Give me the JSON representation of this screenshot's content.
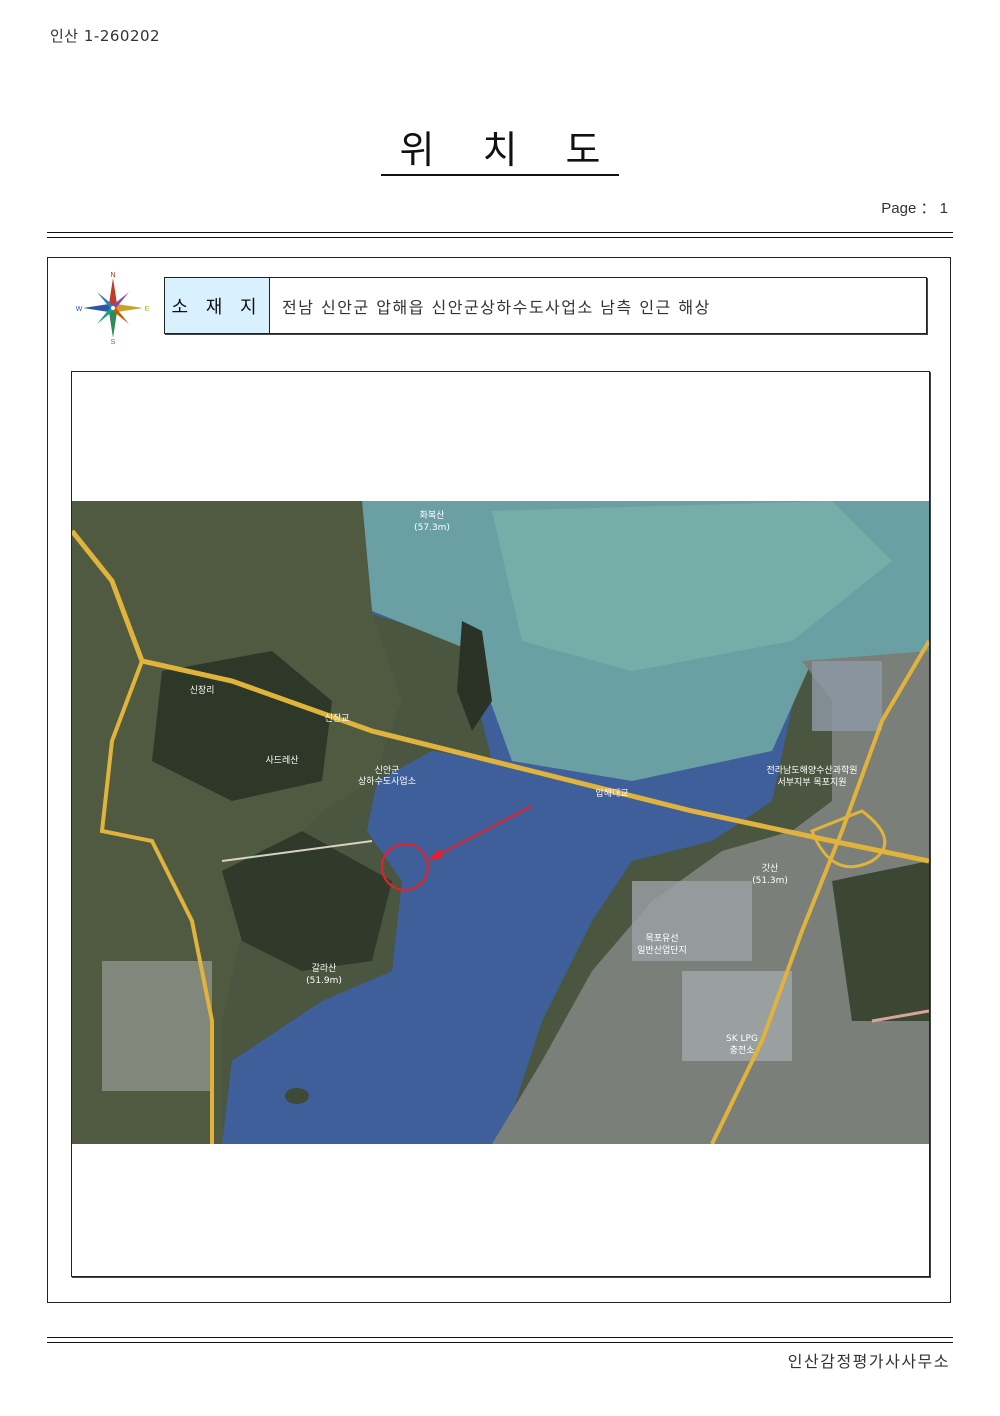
{
  "document": {
    "id": "인산 1-260202",
    "title": "위 치 도",
    "page": "Page ： 1",
    "location_label": "소 재 지",
    "location_value": "전남 신안군 압해읍 신안군상하수도사업소 남측 인근 해상",
    "footer": "인산감정평가사사무소"
  },
  "compass": {
    "north": "N",
    "south": "S",
    "east": "E",
    "west": "W"
  },
  "map": {
    "labels": [
      "화복산",
      "(57.3m)",
      "신장리",
      "사드레산",
      "신안군",
      "상하수도사업소",
      "압해대교",
      "신장교",
      "전라남도해양수산과학원",
      "서부지부 목포지원",
      "갓산",
      "(51.3m)",
      "갈라산",
      "(51.9m)",
      "목포유선",
      "일반산업단지",
      "SK LPG",
      "충전소"
    ],
    "colors": {
      "water": "#3f5f9a",
      "shallow": "#6fa7a5",
      "land": "#4f5a3f",
      "road": "#e0b33c",
      "marker": "#e8202a"
    }
  }
}
